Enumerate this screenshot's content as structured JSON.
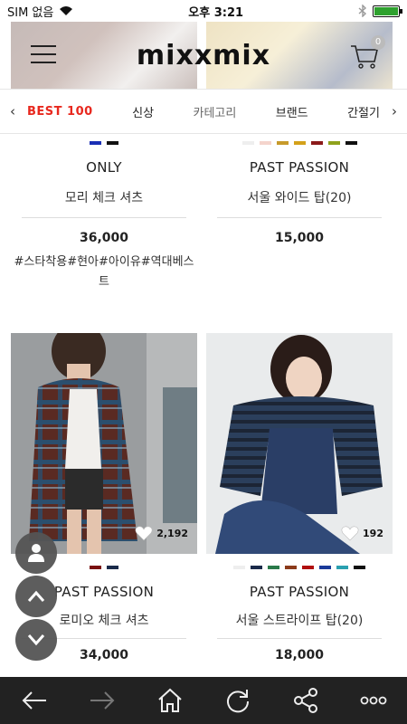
{
  "status_bar": {
    "carrier": "SIM 없음",
    "time": "오후 3:21"
  },
  "header": {
    "logo": "mixxmix",
    "cart_count": "0"
  },
  "nav": {
    "tabs": [
      {
        "label": "BEST 100"
      },
      {
        "label": "신상"
      },
      {
        "label": "카테고리"
      },
      {
        "label": "브랜드"
      },
      {
        "label": "간절기"
      }
    ]
  },
  "products": [
    {
      "swatches": [
        "#1a2fb5",
        "#111111"
      ],
      "brand": "ONLY",
      "name": "모리 체크 셔츠",
      "price": "36,000",
      "tags": "#스타착용#현아#아이유#역대베스트"
    },
    {
      "swatches": [
        "#eeeeee",
        "#f4d4cc",
        "#c79a2a",
        "#d4a11a",
        "#8b1a1a",
        "#8fa21c",
        "#111111"
      ],
      "brand": "PAST PASSION",
      "name": "서울 와이드 탑(20)",
      "price": "15,000"
    },
    {
      "likes": "2,192",
      "swatches": [
        "#7a1010",
        "#1a2a4a"
      ],
      "brand": "PAST PASSION",
      "name": "로미오 체크 셔츠",
      "price": "34,000"
    },
    {
      "likes": "192",
      "swatches": [
        "#eeeeee",
        "#1a2a4a",
        "#2a7a4a",
        "#8b3a1a",
        "#b01010",
        "#1a3a9a",
        "#2aa0b0",
        "#111111"
      ],
      "brand": "PAST PASSION",
      "name": "서울 스트라이프 탑(20)",
      "price": "18,000"
    }
  ],
  "colors": {
    "accent": "#e8281e",
    "bottom_bar": "#222222",
    "fab": "#555555"
  },
  "icons": {
    "menu": "hamburger-icon",
    "cart": "cart-icon",
    "back": "arrow-left-icon",
    "forward": "arrow-right-icon",
    "home": "home-icon",
    "refresh": "refresh-icon",
    "share": "share-icon",
    "more": "more-icon"
  }
}
